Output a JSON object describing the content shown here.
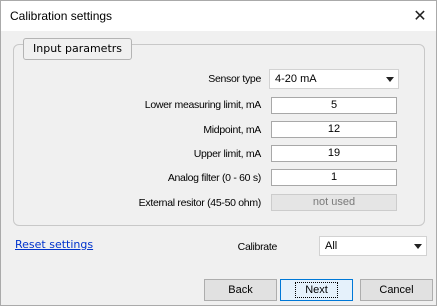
{
  "window": {
    "title": "Calibration settings",
    "close_glyph": "✕"
  },
  "group": {
    "legend": "Input parametrs"
  },
  "sensor_type": {
    "label": "Sensor type",
    "value": "4-20 mA"
  },
  "fields": {
    "lower": {
      "label": "Lower measuring limit, mA",
      "value": "5"
    },
    "mid": {
      "label": "Midpoint, mA",
      "value": "12"
    },
    "upper": {
      "label": "Upper limit, mA",
      "value": "19"
    },
    "filter": {
      "label": "Analog filter (0 - 60 s)",
      "value": "1"
    },
    "resistor": {
      "label": "External resitor (45-50 ohm)",
      "value": "not used"
    }
  },
  "reset_link": "Reset settings",
  "calibrate": {
    "label": "Calibrate",
    "value": "All"
  },
  "buttons": {
    "back": "Back",
    "next": "Next",
    "cancel": "Cancel"
  },
  "colors": {
    "link": "#0033cc",
    "focus": "#0078d7",
    "window_bg": "#f0f0f0"
  }
}
